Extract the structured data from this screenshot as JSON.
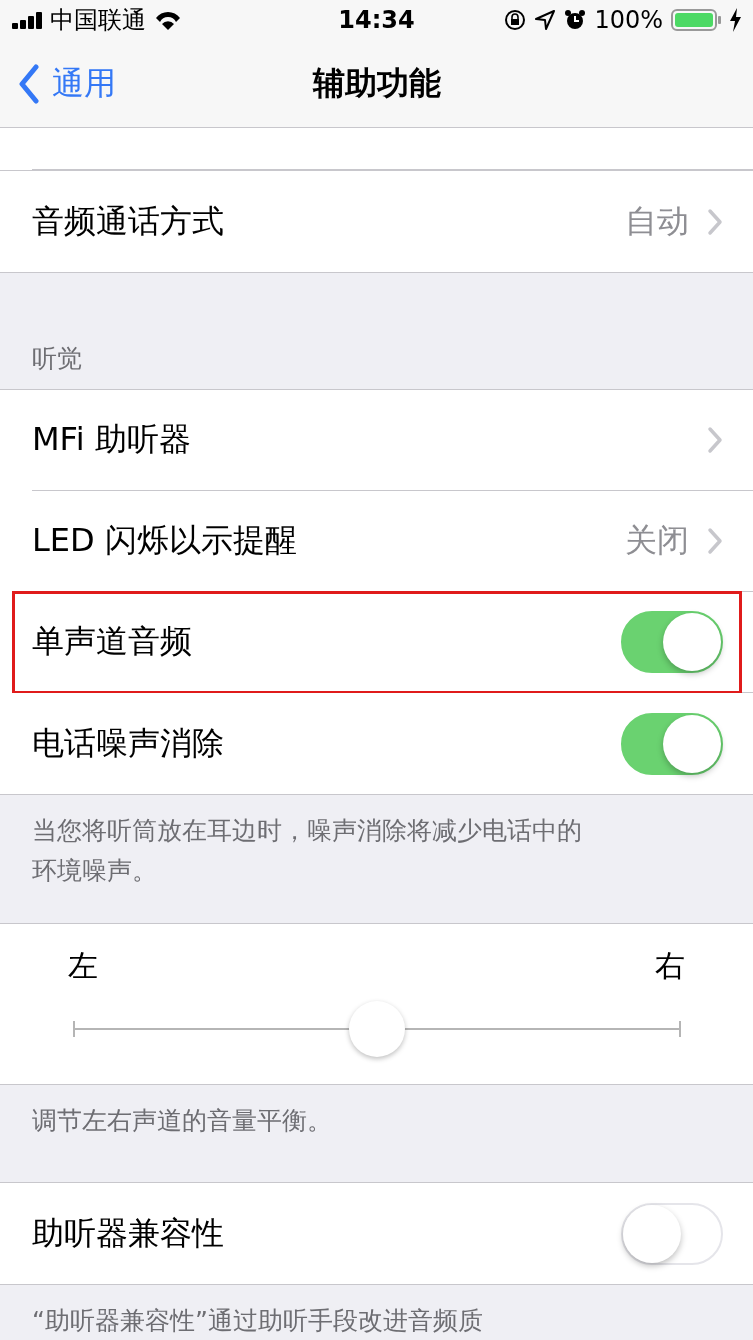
{
  "status_bar": {
    "carrier": "中国联通",
    "time": "14:34",
    "battery": "100%"
  },
  "nav": {
    "back": "通用",
    "title": "辅助功能"
  },
  "sections": [
    {
      "rows": [
        {
          "kind": "link",
          "label": "音频通话方式",
          "value": "自动"
        }
      ]
    },
    {
      "header": "听觉",
      "rows": [
        {
          "kind": "link",
          "label": "MFi 助听器"
        },
        {
          "kind": "link",
          "label": "LED 闪烁以示提醒",
          "value": "关闭"
        },
        {
          "kind": "toggle",
          "label": "单声道音频",
          "on": true,
          "highlighted": true
        },
        {
          "kind": "toggle",
          "label": "电话噪声消除",
          "on": true
        }
      ],
      "footer": "当您将听筒放在耳边时，噪声消除将减少电话中的环境噪声。"
    },
    {
      "balance": {
        "left": "左",
        "right": "右",
        "level": 0.5
      },
      "footer": "调节左右声道的音量平衡。"
    },
    {
      "rows": [
        {
          "kind": "toggle",
          "label": "助听器兼容性",
          "on": false
        }
      ],
      "footer": "“助听器兼容性”通过助听手段改进音频质"
    }
  ]
}
